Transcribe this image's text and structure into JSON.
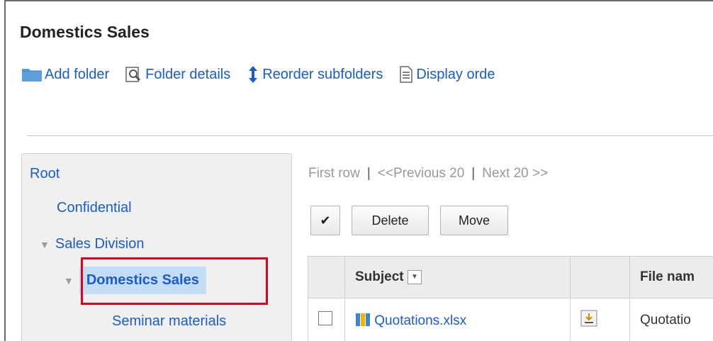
{
  "page_title": "Domestics Sales",
  "toolbar": {
    "add_folder": "Add folder",
    "folder_details": "Folder details",
    "reorder_subfolders": "Reorder subfolders",
    "display_order": "Display orde"
  },
  "tree": {
    "root": "Root",
    "confidential": "Confidential",
    "sales_division": "Sales Division",
    "domestics_sales": "Domestics Sales",
    "seminar_materials": "Seminar materials"
  },
  "pager": {
    "first_row": "First row",
    "separator": "|",
    "previous": "<<Previous 20",
    "next": "Next 20 >>"
  },
  "actions": {
    "check_all": "✔",
    "delete": "Delete",
    "move": "Move"
  },
  "table": {
    "headers": [
      "Subject",
      "File nam"
    ],
    "rows": [
      {
        "subject": "Quotations.xlsx",
        "file_name": "Quotatio"
      }
    ]
  },
  "colors": {
    "link": "#1a5dc8",
    "selected_bg": "#c5dcf5",
    "highlight": "#e0001b"
  }
}
